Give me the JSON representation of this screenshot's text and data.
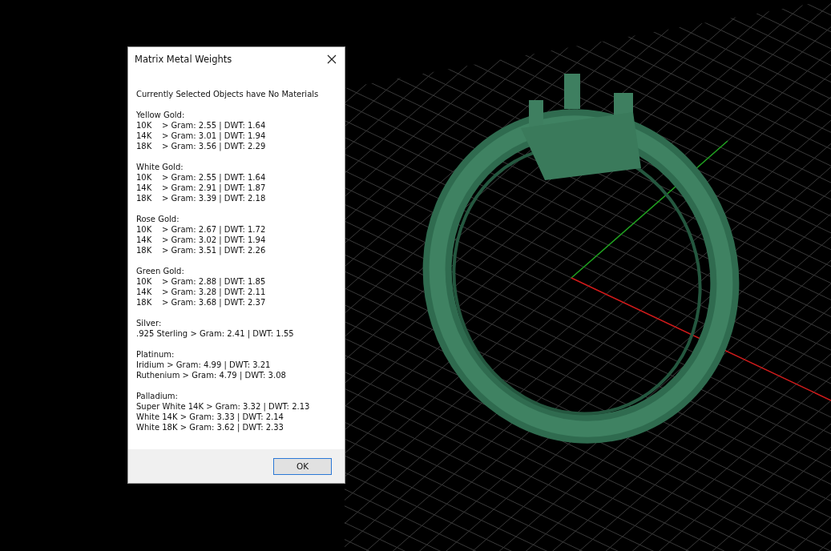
{
  "dialog": {
    "title": "Matrix Metal Weights",
    "message": "Currently Selected Objects have No Materials",
    "groups": [
      {
        "heading": "Yellow Gold:",
        "rows": [
          {
            "kind": "graded",
            "grade": "10K",
            "value": "> Gram: 2.55 | DWT: 1.64"
          },
          {
            "kind": "graded",
            "grade": "14K",
            "value": "> Gram: 3.01 | DWT: 1.94"
          },
          {
            "kind": "graded",
            "grade": "18K",
            "value": "> Gram: 3.56 | DWT: 2.29"
          }
        ]
      },
      {
        "heading": "White Gold:",
        "rows": [
          {
            "kind": "graded",
            "grade": "10K",
            "value": "> Gram: 2.55 | DWT: 1.64"
          },
          {
            "kind": "graded",
            "grade": "14K",
            "value": "> Gram: 2.91 | DWT: 1.87"
          },
          {
            "kind": "graded",
            "grade": "18K",
            "value": "> Gram: 3.39 | DWT: 2.18"
          }
        ]
      },
      {
        "heading": "Rose Gold:",
        "rows": [
          {
            "kind": "graded",
            "grade": "10K",
            "value": "> Gram: 2.67 | DWT: 1.72"
          },
          {
            "kind": "graded",
            "grade": "14K",
            "value": "> Gram: 3.02 | DWT: 1.94"
          },
          {
            "kind": "graded",
            "grade": "18K",
            "value": "> Gram: 3.51 | DWT: 2.26"
          }
        ]
      },
      {
        "heading": "Green Gold:",
        "rows": [
          {
            "kind": "graded",
            "grade": "10K",
            "value": "> Gram: 2.88 | DWT: 1.85"
          },
          {
            "kind": "graded",
            "grade": "14K",
            "value": "> Gram: 3.28 | DWT: 2.11"
          },
          {
            "kind": "graded",
            "grade": "18K",
            "value": "> Gram: 3.68 | DWT: 2.37"
          }
        ]
      },
      {
        "heading": "Silver:",
        "rows": [
          {
            "kind": "plain",
            "text": ".925 Sterling > Gram: 2.41 | DWT: 1.55"
          }
        ]
      },
      {
        "heading": "Platinum:",
        "rows": [
          {
            "kind": "plain",
            "text": "Iridium > Gram: 4.99 | DWT: 3.21"
          },
          {
            "kind": "plain",
            "text": "Ruthenium > Gram: 4.79 | DWT: 3.08"
          }
        ]
      },
      {
        "heading": "Palladium:",
        "rows": [
          {
            "kind": "plain",
            "text": "Super White 14K > Gram: 3.32 | DWT: 2.13"
          },
          {
            "kind": "plain",
            "text": "White 14K > Gram: 3.33 | DWT: 2.14"
          },
          {
            "kind": "plain",
            "text": "White 18K > Gram: 3.62 | DWT: 2.33"
          }
        ]
      }
    ],
    "button": "OK"
  }
}
